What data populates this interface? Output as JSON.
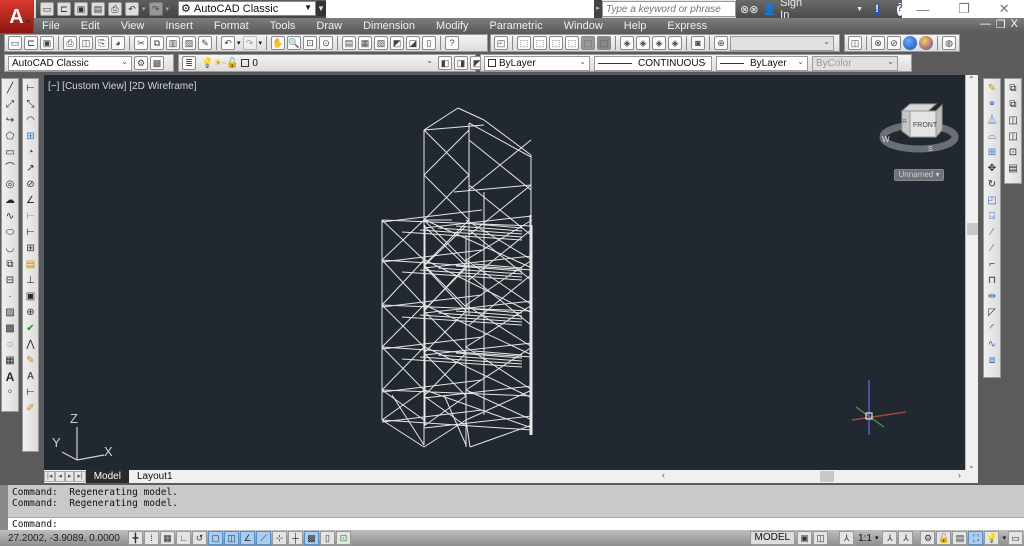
{
  "app": {
    "logo_letter": "A",
    "workspace": "AutoCAD Classic"
  },
  "quick_access": {
    "icons": [
      "new-icon",
      "open-icon",
      "save-icon",
      "save-as-icon",
      "print-icon",
      "undo-icon",
      "redo-icon"
    ]
  },
  "search": {
    "placeholder": "Type a keyword or phrase"
  },
  "signin": {
    "label": "Sign In"
  },
  "window_controls": {
    "minimize": "—",
    "restore": "❐",
    "close": "✕"
  },
  "menubar": {
    "items": [
      "File",
      "Edit",
      "View",
      "Insert",
      "Format",
      "Tools",
      "Draw",
      "Dimension",
      "Modify",
      "Parametric",
      "Window",
      "Help",
      "Express"
    ]
  },
  "doc_controls": {
    "minimize": "—",
    "restore": "❐",
    "close": "X"
  },
  "standard_toolbar": {
    "icons": [
      "new",
      "open",
      "save",
      "plot",
      "plot-preview",
      "publish",
      "3d-print",
      "cut",
      "copy",
      "paste",
      "match-properties",
      "block-editor",
      "undo",
      "redo",
      "pan",
      "zoom-realtime",
      "zoom-window",
      "zoom-previous",
      "properties",
      "design-center",
      "tool-palettes",
      "sheet-set",
      "markup",
      "quickcalc",
      "help"
    ]
  },
  "views_toolbar": {
    "icons": [
      "named-views",
      "top",
      "bottom",
      "left",
      "right",
      "front",
      "back",
      "sw-iso",
      "se-iso",
      "ne-iso",
      "nw-iso",
      "camera",
      "ucs"
    ]
  },
  "visual_styles_toolbar": {
    "icons": [
      "2d-wireframe",
      "3d-hidden",
      "realistic",
      "conceptual",
      "shaded",
      "manager"
    ]
  },
  "workspace_toolbar": {
    "value": "AutoCAD Classic"
  },
  "layers_toolbar": {
    "layer_value": "0"
  },
  "properties_toolbar": {
    "color": "ByLayer",
    "linetype": "CONTINUOUS",
    "lineweight": "ByLayer",
    "plotstyle": "ByColor"
  },
  "viewport": {
    "label": "[−] [Custom View] [2D Wireframe]",
    "viewcube_face": "FRONT",
    "viewcube_side": "R",
    "compass_w": "W",
    "compass_s": "S",
    "named_view": "Unnamed",
    "ucs_x": "X",
    "ucs_y": "Y",
    "ucs_z": "Z",
    "bg_color": "#212830",
    "wire_color": "#e8e8e8"
  },
  "layout_tabs": {
    "tabs": [
      "Model",
      "Layout1"
    ],
    "active": "Model"
  },
  "command": {
    "history": [
      "Command:  Regenerating model.",
      "Command:  Regenerating model."
    ],
    "prompt": "Command:"
  },
  "status": {
    "coordinates": "27.2002, -3.9089, 0.0000",
    "model_label": "MODEL",
    "annotation_scale": "1:1"
  }
}
